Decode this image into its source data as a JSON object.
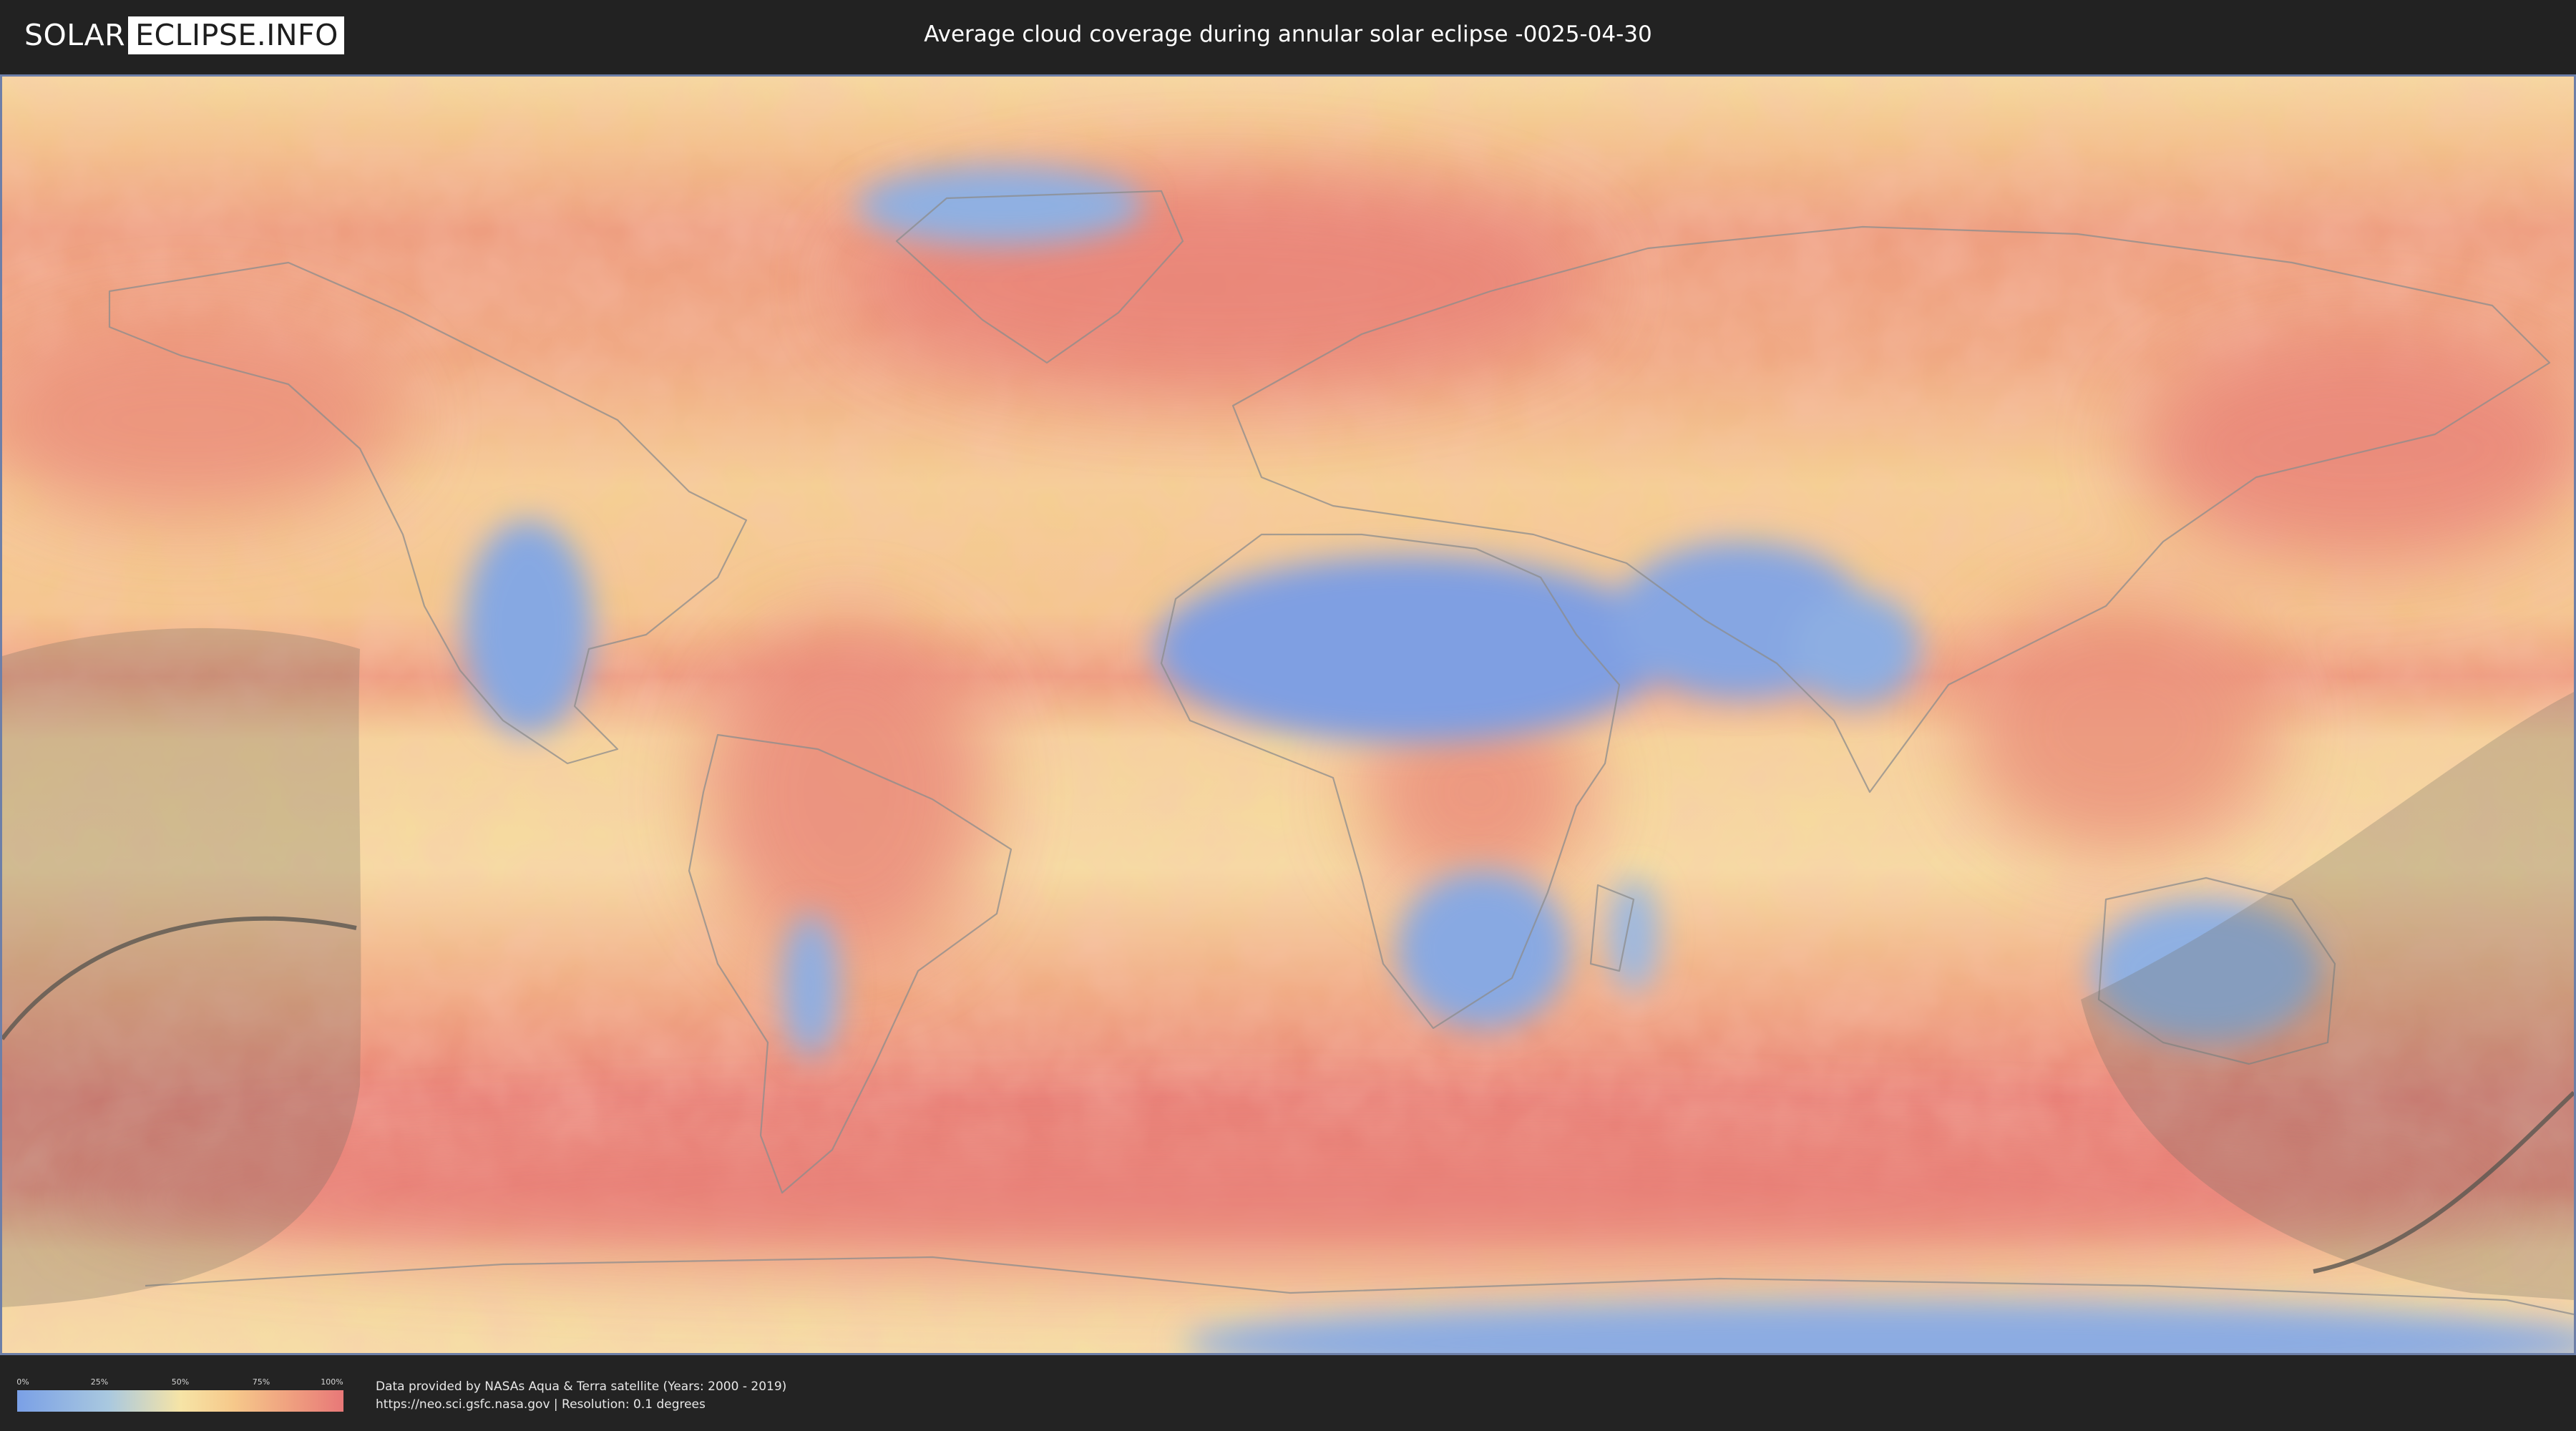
{
  "header": {
    "logo_left": "SOLAR",
    "logo_right": "ECLIPSE.INFO",
    "title": "Average cloud coverage during annular solar eclipse -0025-04-30"
  },
  "legend": {
    "ticks": [
      "0%",
      "25%",
      "50%",
      "75%",
      "100%"
    ],
    "tick_values": [
      0,
      25,
      50,
      75,
      100
    ],
    "color_stops": [
      "#7aa0e6",
      "#a9c8df",
      "#f6e4a6",
      "#f6c98b",
      "#ef9f7f",
      "#e87878"
    ]
  },
  "footer": {
    "credit_line1": "Data provided by NASAs Aqua & Terra satellite (Years: 2000 - 2019)",
    "credit_line2": "https://neo.sci.gsfc.nasa.gov | Resolution: 0.1 degrees"
  },
  "map": {
    "projection": "equirectangular",
    "palette": {
      "clear": "#7b9fe4",
      "low": "#a8c6e0",
      "mid": "#f6e3a4",
      "high": "#f4c48a",
      "overcast": "#e98a7c",
      "coast": "#8c8c8c",
      "eclipse_shadow": "#706960",
      "central_line": "#5a5650"
    }
  }
}
